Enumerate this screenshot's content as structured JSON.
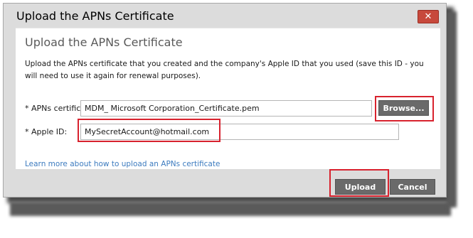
{
  "dialog": {
    "window_title": "Upload the APNs Certificate",
    "close_symbol": "✕",
    "heading": "Upload the APNs Certificate",
    "description": "Upload the APNs certificate that you created and the company's Apple ID that you used (save this ID - you will need to use it again for renewal purposes).",
    "apns": {
      "label": "* APNs certificate:",
      "value": "MDM_ Microsoft Corporation_Certificate.pem",
      "browse_label": "Browse..."
    },
    "appleid": {
      "label": "* Apple ID:",
      "value": "MySecretAccount@hotmail.com"
    },
    "learn_more": "Learn more about how to upload an APNs certificate",
    "upload_label": "Upload",
    "cancel_label": "Cancel"
  },
  "colors": {
    "highlight": "#d8222e",
    "button": "#6a6a6a",
    "close": "#c7493c",
    "link": "#3c7bbf"
  },
  "icons": [
    "close-icon"
  ]
}
